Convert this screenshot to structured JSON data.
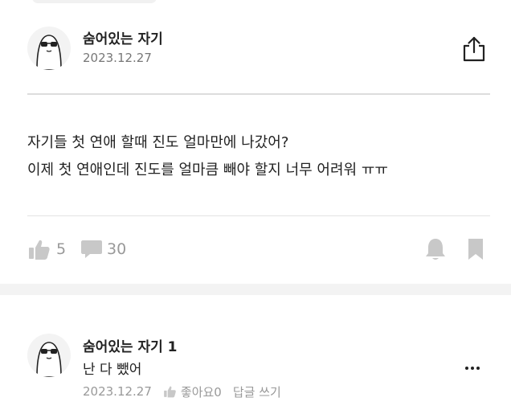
{
  "post": {
    "author": "숨어있는 자기",
    "date": "2023.12.27",
    "lines": [
      "자기들 첫 연애 할때 진도 얼마만에 나갔어?",
      "이제 첫 연애인데 진도를 얼마큼 빼야 할지 너무 어려워 ㅠㅠ"
    ],
    "like_count": "5",
    "comment_count": "30"
  },
  "comment": {
    "author": "숨어있는 자기 1",
    "text": "난 다 뺐어",
    "date": "2023.12.27",
    "like_label": "좋아요0",
    "reply_label": "답글 쓰기"
  },
  "icons": {
    "share": "share-icon",
    "like": "thumbs-up-icon",
    "comment": "speech-bubble-icon",
    "bell": "bell-icon",
    "bookmark": "bookmark-icon",
    "more": "more-dots-icon"
  },
  "colors": {
    "icon_gray": "#c8c8c8",
    "muted_text": "#999999",
    "divider": "#e3e3e3",
    "band": "#f3f3f3"
  }
}
